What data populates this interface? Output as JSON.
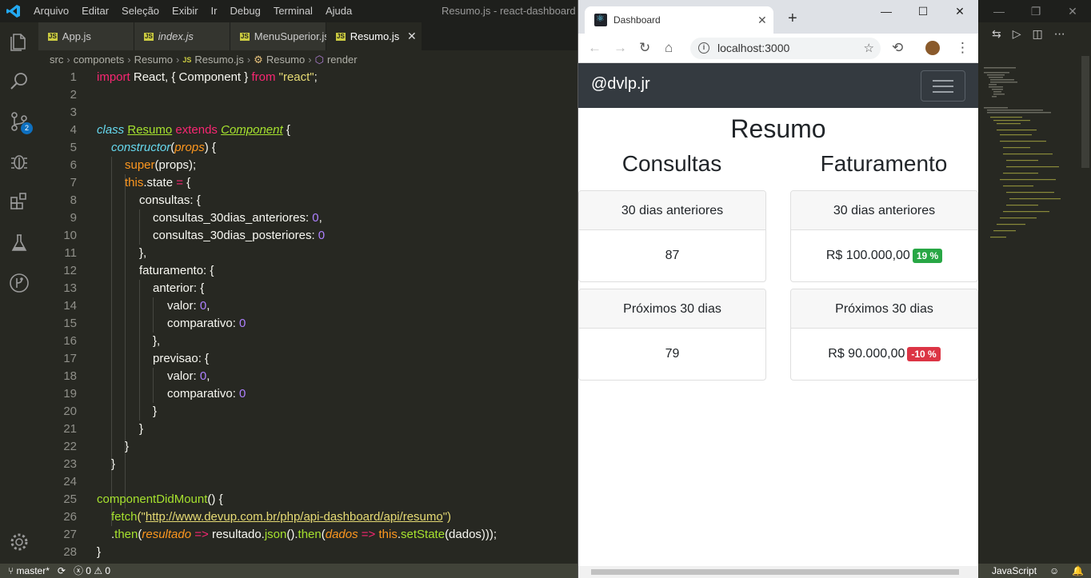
{
  "vscode": {
    "menu": [
      "Arquivo",
      "Editar",
      "Seleção",
      "Exibir",
      "Ir",
      "Debug",
      "Terminal",
      "Ajuda"
    ],
    "window_title": "Resumo.js - react-dashboard - V",
    "tabs": [
      {
        "label": "App.js",
        "italic": false
      },
      {
        "label": "index.js",
        "italic": true
      },
      {
        "label": "MenuSuperior.js",
        "italic": false
      },
      {
        "label": "Resumo.js",
        "italic": false,
        "active": true
      }
    ],
    "scm_badge": "2",
    "breadcrumbs": [
      "src",
      "componets",
      "Resumo",
      "Resumo.js",
      "Resumo",
      "render"
    ],
    "line_numbers": [
      "1",
      "2",
      "3",
      "4",
      "5",
      "6",
      "7",
      "8",
      "9",
      "10",
      "11",
      "12",
      "13",
      "14",
      "15",
      "16",
      "17",
      "18",
      "19",
      "20",
      "21",
      "22",
      "23",
      "24",
      "25",
      "26",
      "27",
      "28"
    ],
    "code": {
      "l1": [
        "import",
        " React, { Component } ",
        "from",
        " ",
        "\"react\"",
        ";"
      ],
      "l4": [
        "class",
        " ",
        "Resumo",
        " ",
        "extends",
        " ",
        "Component",
        " {"
      ],
      "l5": [
        "constructor",
        "(",
        "props",
        ") {"
      ],
      "l6": [
        "super",
        "(props);"
      ],
      "l7": [
        "this",
        ".state ",
        "=",
        " {"
      ],
      "l8": "consultas: {",
      "l9": [
        "consultas_30dias_anteriores: ",
        "0",
        ","
      ],
      "l10": [
        "consultas_30dias_posteriores: ",
        "0"
      ],
      "l11": "},",
      "l12": "faturamento: {",
      "l13": "anterior: {",
      "l14": [
        "valor: ",
        "0",
        ","
      ],
      "l15": [
        "comparativo: ",
        "0"
      ],
      "l16": "},",
      "l17": "previsao: {",
      "l18": [
        "valor: ",
        "0",
        ","
      ],
      "l19": [
        "comparativo: ",
        "0"
      ],
      "l20": "}",
      "l21": "}",
      "l22": "}",
      "l23": "}",
      "l25": [
        "componentDidMount",
        "() {"
      ],
      "l26": [
        "fetch",
        "(\"",
        "http://www.devup.com.br/php/api-dashboard/api/resumo",
        "\")"
      ],
      "l27": [
        ".",
        "then",
        "(",
        "resultado",
        " ",
        "=>",
        " resultado.",
        "json",
        "().",
        "then",
        "(",
        "dados",
        " ",
        "=>",
        " ",
        "this",
        ".",
        "setState",
        "(dados)));"
      ],
      "l28": "}"
    },
    "status": {
      "branch": "master*",
      "errors": "0",
      "warnings": "0",
      "language": "JavaScript"
    }
  },
  "browser": {
    "tab_title": "Dashboard",
    "url": "localhost:3000",
    "navbar_brand": "@dvlp.jr",
    "page": {
      "heading": "Resumo",
      "consultas": {
        "title": "Consultas",
        "cards": [
          {
            "header": "30 dias anteriores",
            "value": "87"
          },
          {
            "header": "Próximos 30 dias",
            "value": "79"
          }
        ]
      },
      "faturamento": {
        "title": "Faturamento",
        "cards": [
          {
            "header": "30 dias anteriores",
            "value": "R$ 100.000,00",
            "badge": "19 %",
            "badge_color": "#28a745"
          },
          {
            "header": "Próximos 30 dias",
            "value": "R$ 90.000,00",
            "badge": "-10 %",
            "badge_color": "#dc3545"
          }
        ]
      }
    }
  }
}
